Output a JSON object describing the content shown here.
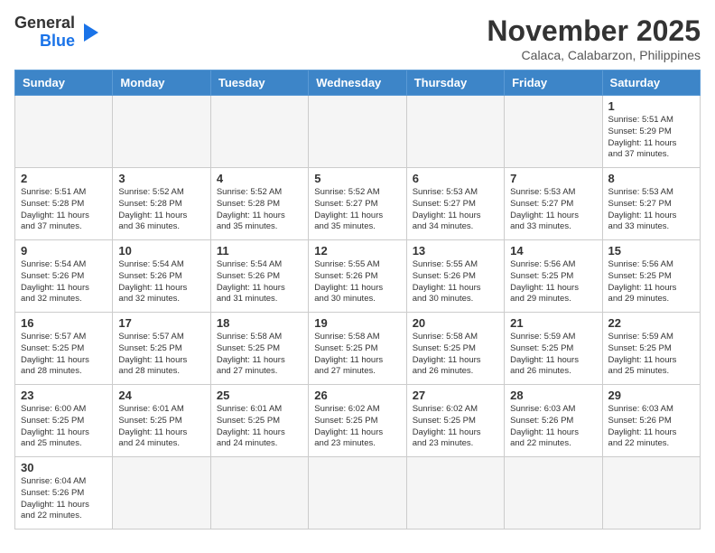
{
  "header": {
    "logo_general": "General",
    "logo_blue": "Blue",
    "month_title": "November 2025",
    "location": "Calaca, Calabarzon, Philippines"
  },
  "weekdays": [
    "Sunday",
    "Monday",
    "Tuesday",
    "Wednesday",
    "Thursday",
    "Friday",
    "Saturday"
  ],
  "weeks": [
    [
      {
        "day": "",
        "info": ""
      },
      {
        "day": "",
        "info": ""
      },
      {
        "day": "",
        "info": ""
      },
      {
        "day": "",
        "info": ""
      },
      {
        "day": "",
        "info": ""
      },
      {
        "day": "",
        "info": ""
      },
      {
        "day": "1",
        "info": "Sunrise: 5:51 AM\nSunset: 5:29 PM\nDaylight: 11 hours\nand 37 minutes."
      }
    ],
    [
      {
        "day": "2",
        "info": "Sunrise: 5:51 AM\nSunset: 5:28 PM\nDaylight: 11 hours\nand 37 minutes."
      },
      {
        "day": "3",
        "info": "Sunrise: 5:52 AM\nSunset: 5:28 PM\nDaylight: 11 hours\nand 36 minutes."
      },
      {
        "day": "4",
        "info": "Sunrise: 5:52 AM\nSunset: 5:28 PM\nDaylight: 11 hours\nand 35 minutes."
      },
      {
        "day": "5",
        "info": "Sunrise: 5:52 AM\nSunset: 5:27 PM\nDaylight: 11 hours\nand 35 minutes."
      },
      {
        "day": "6",
        "info": "Sunrise: 5:53 AM\nSunset: 5:27 PM\nDaylight: 11 hours\nand 34 minutes."
      },
      {
        "day": "7",
        "info": "Sunrise: 5:53 AM\nSunset: 5:27 PM\nDaylight: 11 hours\nand 33 minutes."
      },
      {
        "day": "8",
        "info": "Sunrise: 5:53 AM\nSunset: 5:27 PM\nDaylight: 11 hours\nand 33 minutes."
      }
    ],
    [
      {
        "day": "9",
        "info": "Sunrise: 5:54 AM\nSunset: 5:26 PM\nDaylight: 11 hours\nand 32 minutes."
      },
      {
        "day": "10",
        "info": "Sunrise: 5:54 AM\nSunset: 5:26 PM\nDaylight: 11 hours\nand 32 minutes."
      },
      {
        "day": "11",
        "info": "Sunrise: 5:54 AM\nSunset: 5:26 PM\nDaylight: 11 hours\nand 31 minutes."
      },
      {
        "day": "12",
        "info": "Sunrise: 5:55 AM\nSunset: 5:26 PM\nDaylight: 11 hours\nand 30 minutes."
      },
      {
        "day": "13",
        "info": "Sunrise: 5:55 AM\nSunset: 5:26 PM\nDaylight: 11 hours\nand 30 minutes."
      },
      {
        "day": "14",
        "info": "Sunrise: 5:56 AM\nSunset: 5:25 PM\nDaylight: 11 hours\nand 29 minutes."
      },
      {
        "day": "15",
        "info": "Sunrise: 5:56 AM\nSunset: 5:25 PM\nDaylight: 11 hours\nand 29 minutes."
      }
    ],
    [
      {
        "day": "16",
        "info": "Sunrise: 5:57 AM\nSunset: 5:25 PM\nDaylight: 11 hours\nand 28 minutes."
      },
      {
        "day": "17",
        "info": "Sunrise: 5:57 AM\nSunset: 5:25 PM\nDaylight: 11 hours\nand 28 minutes."
      },
      {
        "day": "18",
        "info": "Sunrise: 5:58 AM\nSunset: 5:25 PM\nDaylight: 11 hours\nand 27 minutes."
      },
      {
        "day": "19",
        "info": "Sunrise: 5:58 AM\nSunset: 5:25 PM\nDaylight: 11 hours\nand 27 minutes."
      },
      {
        "day": "20",
        "info": "Sunrise: 5:58 AM\nSunset: 5:25 PM\nDaylight: 11 hours\nand 26 minutes."
      },
      {
        "day": "21",
        "info": "Sunrise: 5:59 AM\nSunset: 5:25 PM\nDaylight: 11 hours\nand 26 minutes."
      },
      {
        "day": "22",
        "info": "Sunrise: 5:59 AM\nSunset: 5:25 PM\nDaylight: 11 hours\nand 25 minutes."
      }
    ],
    [
      {
        "day": "23",
        "info": "Sunrise: 6:00 AM\nSunset: 5:25 PM\nDaylight: 11 hours\nand 25 minutes."
      },
      {
        "day": "24",
        "info": "Sunrise: 6:01 AM\nSunset: 5:25 PM\nDaylight: 11 hours\nand 24 minutes."
      },
      {
        "day": "25",
        "info": "Sunrise: 6:01 AM\nSunset: 5:25 PM\nDaylight: 11 hours\nand 24 minutes."
      },
      {
        "day": "26",
        "info": "Sunrise: 6:02 AM\nSunset: 5:25 PM\nDaylight: 11 hours\nand 23 minutes."
      },
      {
        "day": "27",
        "info": "Sunrise: 6:02 AM\nSunset: 5:25 PM\nDaylight: 11 hours\nand 23 minutes."
      },
      {
        "day": "28",
        "info": "Sunrise: 6:03 AM\nSunset: 5:26 PM\nDaylight: 11 hours\nand 22 minutes."
      },
      {
        "day": "29",
        "info": "Sunrise: 6:03 AM\nSunset: 5:26 PM\nDaylight: 11 hours\nand 22 minutes."
      }
    ],
    [
      {
        "day": "30",
        "info": "Sunrise: 6:04 AM\nSunset: 5:26 PM\nDaylight: 11 hours\nand 22 minutes."
      },
      {
        "day": "",
        "info": ""
      },
      {
        "day": "",
        "info": ""
      },
      {
        "day": "",
        "info": ""
      },
      {
        "day": "",
        "info": ""
      },
      {
        "day": "",
        "info": ""
      },
      {
        "day": "",
        "info": ""
      }
    ]
  ]
}
